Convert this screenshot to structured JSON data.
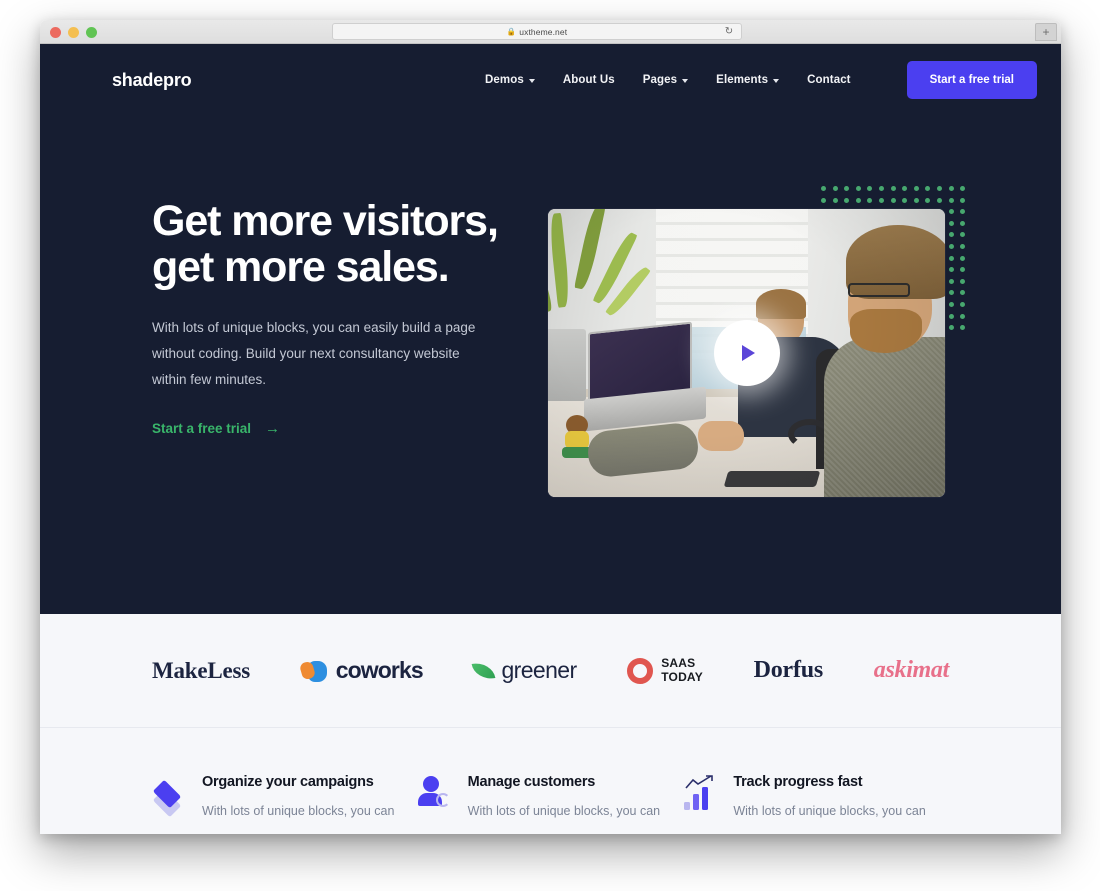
{
  "browser": {
    "url": "uxtheme.net",
    "lock_icon": "lock-icon",
    "reload_icon": "↻",
    "newtab_label": "+",
    "traffic_lights": [
      "close",
      "minimize",
      "maximize"
    ]
  },
  "colors": {
    "hero_bg": "#161d31",
    "accent_indigo": "#4b3ff0",
    "accent_green": "#39b56a",
    "dot_green": "#47a86f",
    "band_bg": "#f6f7fa",
    "body_text": "#7c8496"
  },
  "header": {
    "logo": "shadepro",
    "nav": [
      {
        "label": "Demos",
        "has_caret": true
      },
      {
        "label": "About Us",
        "has_caret": false
      },
      {
        "label": "Pages",
        "has_caret": true
      },
      {
        "label": "Elements",
        "has_caret": true
      },
      {
        "label": "Contact",
        "has_caret": false
      }
    ],
    "cta_label": "Start a free trial"
  },
  "hero": {
    "title_line1": "Get more visitors,",
    "title_line2": "get more sales.",
    "subtitle": "With lots of unique blocks, you can easily build a page without coding. Build your next consultancy website within few minutes.",
    "cta_label": "Start a free trial",
    "cta_arrow": "→",
    "media": {
      "play_icon": "play-icon",
      "alt": "Two developers working at desks with laptops in a bright office"
    },
    "decoration": {
      "dot_grid_columns": 13,
      "dot_grid_rows": 13,
      "dot_color": "#47a86f"
    }
  },
  "logos": [
    {
      "name": "MakeLess",
      "icon": "none"
    },
    {
      "name": "coworks",
      "icon": "waving-hands-icon"
    },
    {
      "name": "greener",
      "icon": "leaf-icon"
    },
    {
      "name": "SAAS TODAY",
      "line1": "SAAS",
      "line2": "TODAY",
      "icon": "ring-icon"
    },
    {
      "name": "Dorfus",
      "icon": "none"
    },
    {
      "name": "askimat",
      "icon": "none"
    }
  ],
  "features": [
    {
      "icon": "layers-diamond-icon",
      "title": "Organize your campaigns",
      "desc": "With lots of unique blocks, you can"
    },
    {
      "icon": "user-sync-icon",
      "title": "Manage customers",
      "desc": "With lots of unique blocks, you can"
    },
    {
      "icon": "bar-chart-trend-icon",
      "title": "Track progress fast",
      "desc": "With lots of unique blocks, you can"
    }
  ]
}
